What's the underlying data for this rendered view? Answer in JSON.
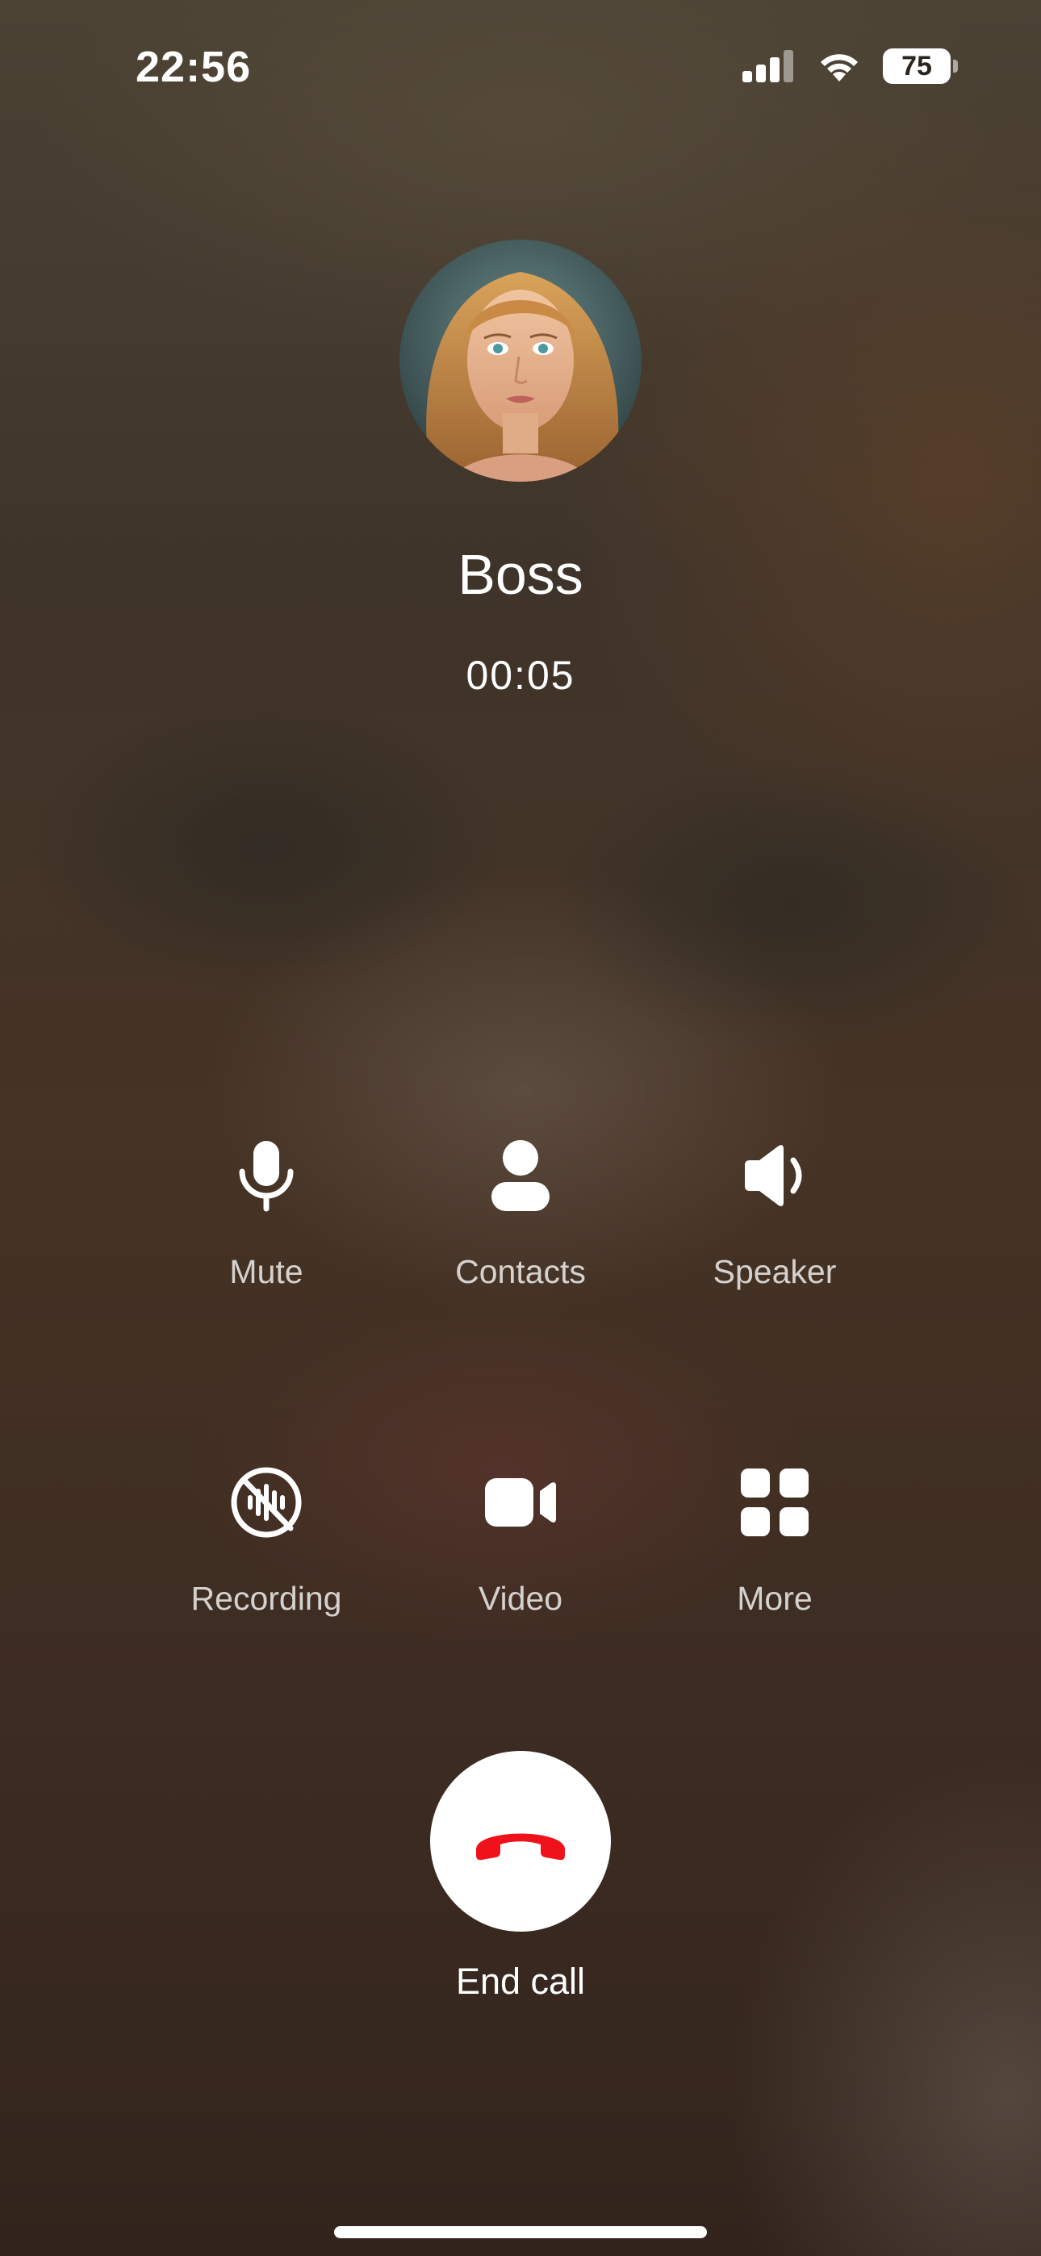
{
  "status_bar": {
    "time": "22:56",
    "battery_level": "75",
    "icons": [
      "cellular-signal-icon",
      "wifi-icon",
      "battery-icon"
    ]
  },
  "caller": {
    "name": "Boss",
    "duration": "00:05",
    "avatar": "caller-photo"
  },
  "controls": {
    "mute": {
      "label": "Mute",
      "icon": "microphone-icon"
    },
    "contacts": {
      "label": "Contacts",
      "icon": "person-icon"
    },
    "speaker": {
      "label": "Speaker",
      "icon": "speaker-icon"
    },
    "recording": {
      "label": "Recording",
      "icon": "recording-off-icon"
    },
    "video": {
      "label": "Video",
      "icon": "video-camera-icon"
    },
    "more": {
      "label": "More",
      "icon": "grid-icon"
    }
  },
  "end_call": {
    "label": "End call",
    "icon": "hang-up-icon",
    "color": "#f0121b"
  }
}
